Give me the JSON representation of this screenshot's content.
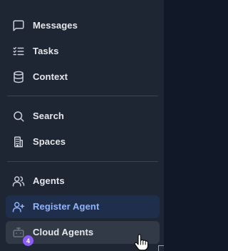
{
  "nav": {
    "messages": {
      "label": "Messages",
      "icon": "message-square-icon"
    },
    "tasks": {
      "label": "Tasks",
      "icon": "list-checks-icon"
    },
    "context": {
      "label": "Context",
      "icon": "database-icon"
    },
    "search": {
      "label": "Search",
      "icon": "search-icon"
    },
    "spaces": {
      "label": "Spaces",
      "icon": "building-icon"
    },
    "agents": {
      "label": "Agents",
      "icon": "users-icon"
    },
    "register_agent": {
      "label": "Register Agent",
      "icon": "user-plus-icon"
    },
    "cloud_agents": {
      "label": "Cloud Agents",
      "icon": "bot-icon",
      "badge": "4"
    }
  },
  "colors": {
    "sidebar_bg": "#1e2533",
    "text": "#e5e7eb",
    "accent_text": "#8fb4ff",
    "active_bg": "#1f2e4a",
    "hover_bg": "#333a47",
    "badge_bg": "#8b5cf6"
  }
}
